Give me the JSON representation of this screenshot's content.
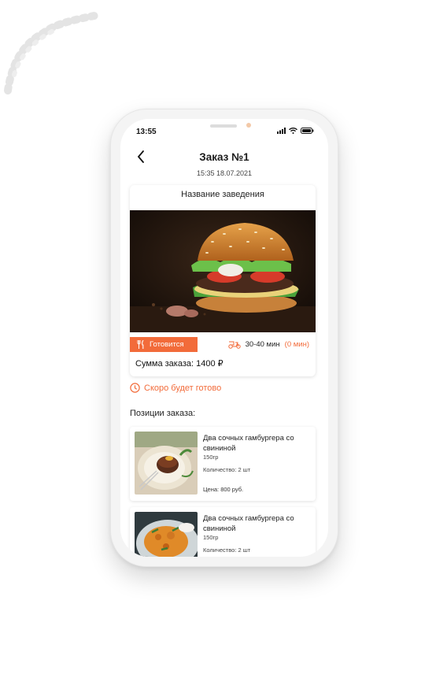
{
  "status_bar": {
    "time": "13:55"
  },
  "header": {
    "title": "Заказ №1",
    "date": "15:35 18.07.2021"
  },
  "order": {
    "venue": "Название заведения",
    "status_label": "Готовится",
    "delivery_time": "30-40 мин",
    "delivery_extra": "(0 мин)",
    "total": "Сумма заказа: 1400 ₽"
  },
  "notice": "Скоро будет готово",
  "positions": {
    "title": "Позиции заказа:",
    "items": [
      {
        "name": "Два сочных гамбургера со свининой",
        "weight": "150гр",
        "qty": "Количество: 2 шт",
        "price": "Цена: 800 руб."
      },
      {
        "name": "Два сочных гамбургера со свининой",
        "weight": "150гр",
        "qty": "Количество: 2 шт"
      }
    ]
  },
  "icons": [
    "back-arrow-icon",
    "signal-icon",
    "wifi-icon",
    "battery-icon",
    "fork-knife-icon",
    "delivery-scooter-icon",
    "clock-icon"
  ],
  "colors": {
    "accent": "#f26b3a",
    "text": "#222222"
  }
}
